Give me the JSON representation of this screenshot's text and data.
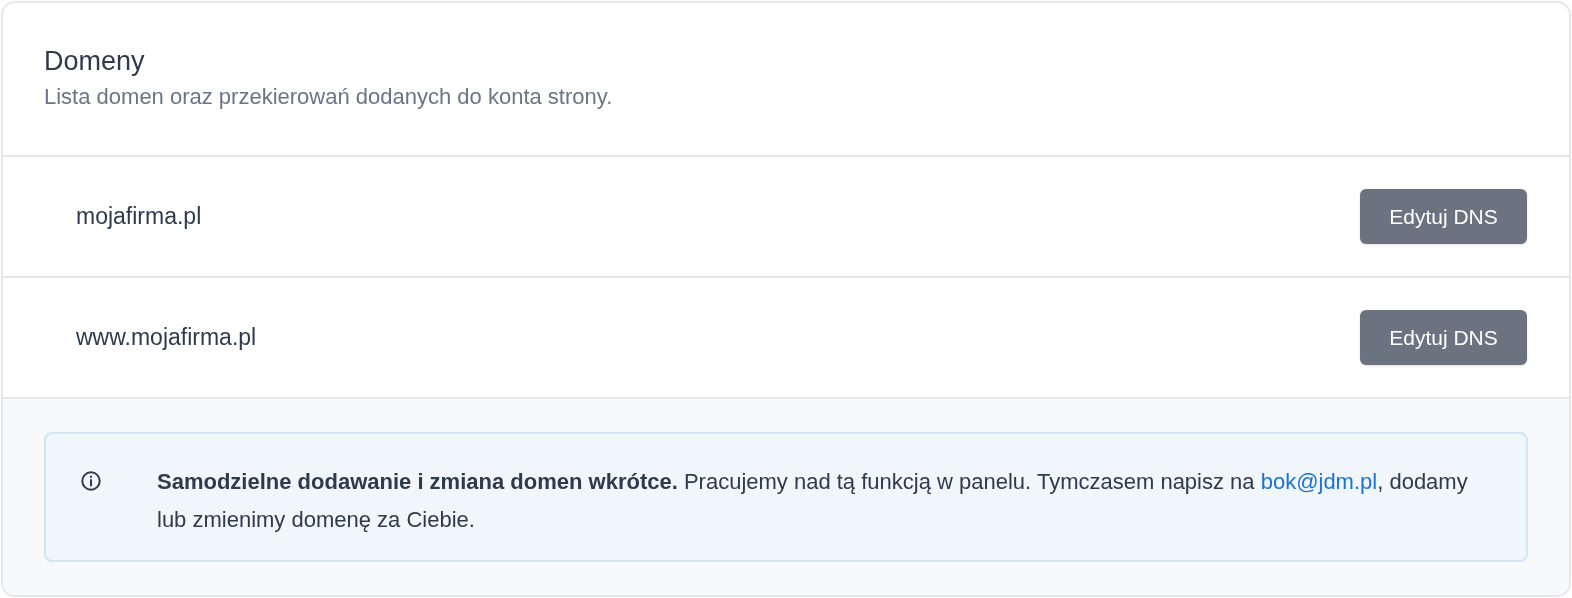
{
  "header": {
    "title": "Domeny",
    "subtitle": "Lista domen oraz przekierowań dodanych do konta strony."
  },
  "domains": [
    {
      "name": "mojafirma.pl",
      "button": "Edytuj DNS"
    },
    {
      "name": "www.mojafirma.pl",
      "button": "Edytuj DNS"
    }
  ],
  "notice": {
    "text_before": "**Samodzielne dodawanie i zmiana domen wkrótce.** Pracujemy nad tą funkcją w panelu. Tymczasem napisz na ",
    "link": "bok@jdm.pl",
    "text_after": ", dodamy lub zmienimy domenę za Ciebie."
  }
}
